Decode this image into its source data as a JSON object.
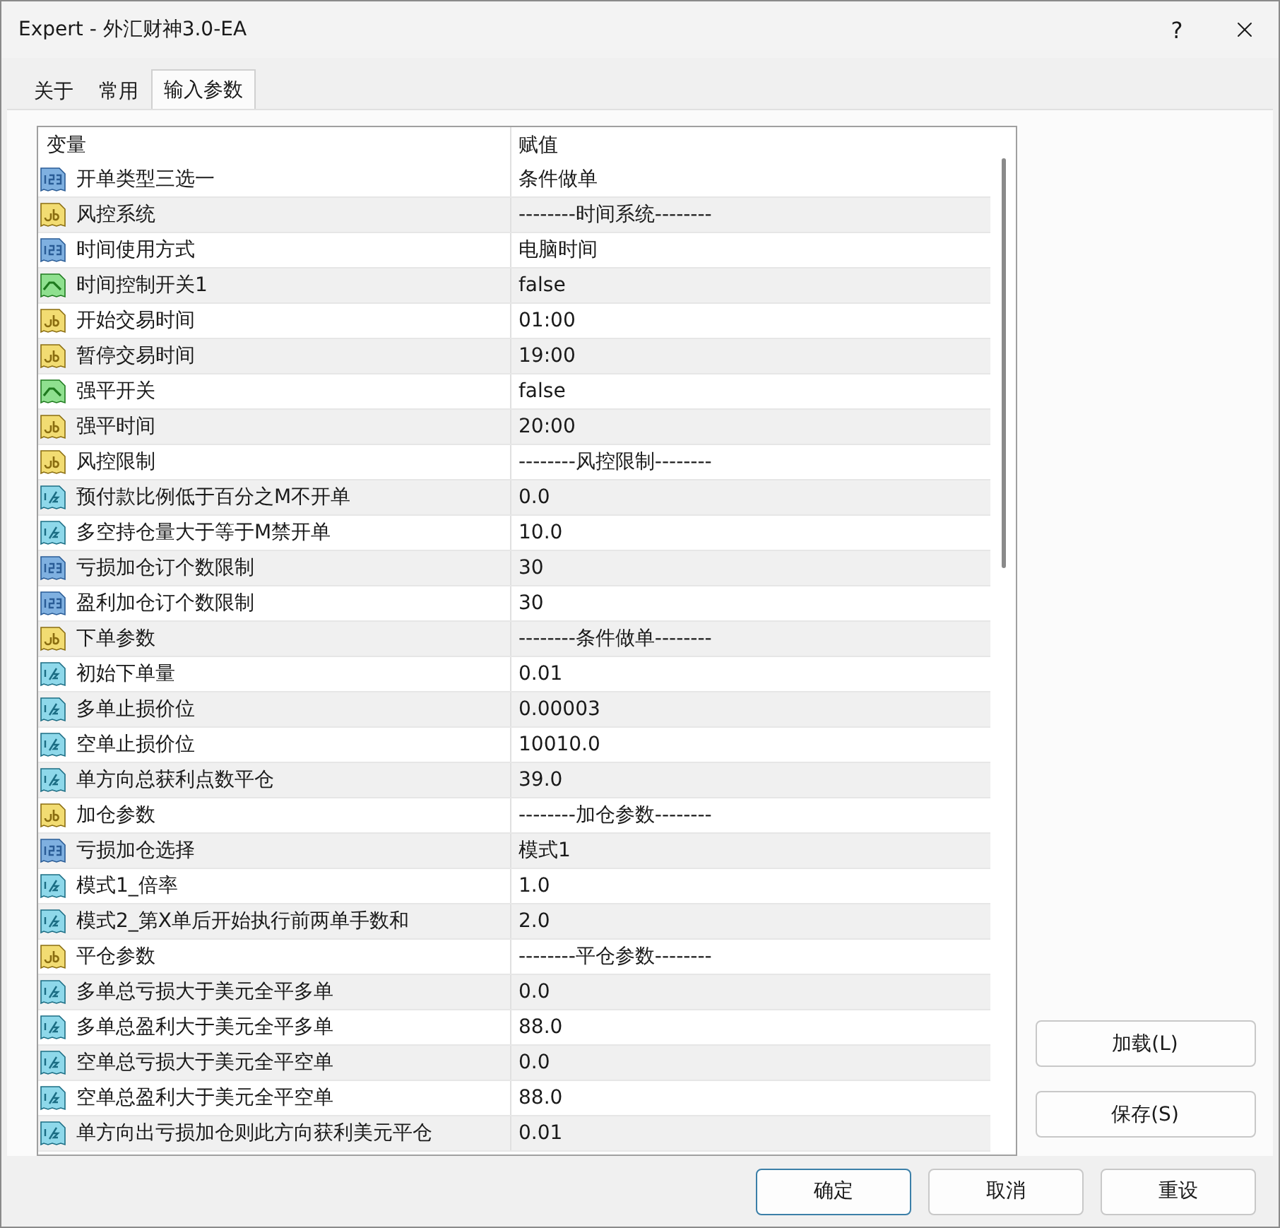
{
  "window": {
    "title": "Expert - 外汇财神3.0-EA",
    "help": "?"
  },
  "tabs": [
    {
      "label": "关于",
      "selected": false
    },
    {
      "label": "常用",
      "selected": false
    },
    {
      "label": "输入参数",
      "selected": true
    }
  ],
  "table": {
    "columns": [
      "变量",
      "赋值"
    ],
    "rows": [
      {
        "kind": "int",
        "name": "开单类型三选一",
        "value": "条件做单"
      },
      {
        "kind": "string",
        "name": "风控系统",
        "value": "--------时间系统--------"
      },
      {
        "kind": "int",
        "name": "时间使用方式",
        "value": "电脑时间"
      },
      {
        "kind": "bool",
        "name": "时间控制开关1",
        "value": "false"
      },
      {
        "kind": "string",
        "name": "开始交易时间",
        "value": "01:00"
      },
      {
        "kind": "string",
        "name": "暂停交易时间",
        "value": "19:00"
      },
      {
        "kind": "bool",
        "name": "强平开关",
        "value": "false"
      },
      {
        "kind": "string",
        "name": "强平时间",
        "value": "20:00"
      },
      {
        "kind": "string",
        "name": "风控限制",
        "value": "--------风控限制--------"
      },
      {
        "kind": "double",
        "name": "预付款比例低于百分之M不开单",
        "value": "0.0"
      },
      {
        "kind": "double",
        "name": "多空持仓量大于等于M禁开单",
        "value": "10.0"
      },
      {
        "kind": "int",
        "name": "亏损加仓订个数限制",
        "value": "30"
      },
      {
        "kind": "int",
        "name": "盈利加仓订个数限制",
        "value": "30"
      },
      {
        "kind": "string",
        "name": "下单参数",
        "value": "--------条件做单--------"
      },
      {
        "kind": "double",
        "name": "初始下单量",
        "value": "0.01"
      },
      {
        "kind": "double",
        "name": "多单止损价位",
        "value": "0.00003"
      },
      {
        "kind": "double",
        "name": "空单止损价位",
        "value": "10010.0"
      },
      {
        "kind": "double",
        "name": "单方向总获利点数平仓",
        "value": "39.0"
      },
      {
        "kind": "string",
        "name": "加仓参数",
        "value": "--------加仓参数--------"
      },
      {
        "kind": "int",
        "name": "亏损加仓选择",
        "value": "模式1"
      },
      {
        "kind": "double",
        "name": "模式1_倍率",
        "value": "1.0"
      },
      {
        "kind": "double",
        "name": "模式2_第X单后开始执行前两单手数和",
        "value": "2.0"
      },
      {
        "kind": "string",
        "name": "平仓参数",
        "value": "--------平仓参数--------"
      },
      {
        "kind": "double",
        "name": "多单总亏损大于美元全平多单",
        "value": "0.0"
      },
      {
        "kind": "double",
        "name": "多单总盈利大于美元全平多单",
        "value": "88.0"
      },
      {
        "kind": "double",
        "name": "空单总亏损大于美元全平空单",
        "value": "0.0"
      },
      {
        "kind": "double",
        "name": "空单总盈利大于美元全平空单",
        "value": "88.0"
      },
      {
        "kind": "double",
        "name": "单方向出亏损加仓则此方向获利美元平仓",
        "value": "0.01"
      }
    ]
  },
  "side_buttons": [
    "加载(L)",
    "保存(S)"
  ],
  "footer_buttons": [
    {
      "label": "确定",
      "default": true
    },
    {
      "label": "取消",
      "default": false
    },
    {
      "label": "重设",
      "default": false
    }
  ]
}
